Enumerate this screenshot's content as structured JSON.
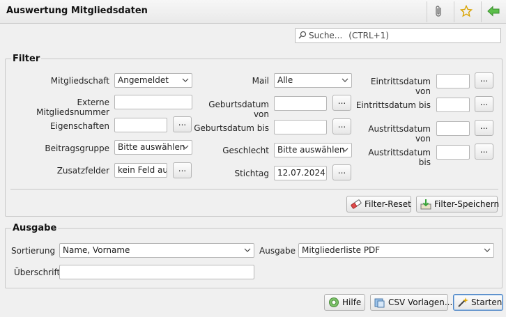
{
  "window": {
    "title": "Auswertung Mitgliedsdaten"
  },
  "search": {
    "placeholder": "Suche...",
    "shortcut": "(CTRL+1)"
  },
  "filter": {
    "legend": "Filter",
    "mitgliedschaft": {
      "label": "Mitgliedschaft",
      "value": "Angemeldet"
    },
    "externe_nr": {
      "label": "Externe Mitgliedsnummer",
      "value": ""
    },
    "eigenschaften": {
      "label": "Eigenschaften",
      "value": ""
    },
    "beitragsgruppe": {
      "label": "Beitragsgruppe",
      "value": "Bitte auswählen"
    },
    "zusatzfelder": {
      "label": "Zusatzfelder",
      "value": "kein Feld ausgewählt"
    },
    "mail": {
      "label": "Mail",
      "value": "Alle"
    },
    "geb_von": {
      "label": "Geburtsdatum von",
      "value": ""
    },
    "geb_bis": {
      "label": "Geburtsdatum bis",
      "value": ""
    },
    "geschlecht": {
      "label": "Geschlecht",
      "value": "Bitte auswählen"
    },
    "stichtag": {
      "label": "Stichtag",
      "value": "12.07.2024"
    },
    "eintritt_von": {
      "label": "Eintrittsdatum von",
      "value": ""
    },
    "eintritt_bis": {
      "label": "Eintrittsdatum bis",
      "value": ""
    },
    "austritt_von": {
      "label": "Austrittsdatum von",
      "value": ""
    },
    "austritt_bis": {
      "label": "Austrittsdatum bis",
      "value": ""
    },
    "dots_label": "...",
    "reset_label": "Filter-Reset",
    "save_label": "Filter-Speichern"
  },
  "ausgabe": {
    "legend": "Ausgabe",
    "sortierung": {
      "label": "Sortierung",
      "value": "Name, Vorname"
    },
    "ausgabe": {
      "label": "Ausgabe",
      "value": "Mitgliederliste PDF"
    },
    "ueberschrift": {
      "label": "Überschrift",
      "value": ""
    }
  },
  "footer": {
    "help_label": "Hilfe",
    "csv_label": "CSV Vorlagen...",
    "start_label": "Starten"
  },
  "colors": {
    "accent": "#4f86c6",
    "star": "#e0a800",
    "arrow": "#3aa43a"
  }
}
